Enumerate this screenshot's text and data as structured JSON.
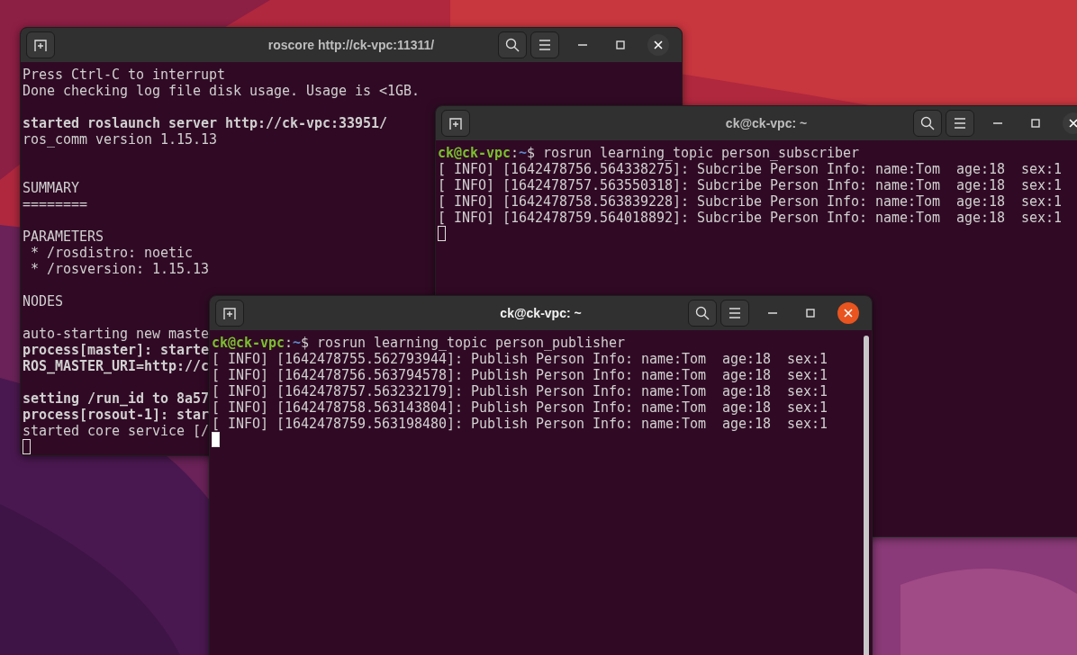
{
  "windows": [
    {
      "title": "roscore http://ck-vpc:11311/",
      "focused": false,
      "scrollbar": false,
      "lines": [
        {
          "kind": "text",
          "text": "Press Ctrl-C to interrupt",
          "bold": false
        },
        {
          "kind": "text",
          "text": "Done checking log file disk usage. Usage is <1GB.",
          "bold": false
        },
        {
          "kind": "blank"
        },
        {
          "kind": "text",
          "text": "started roslaunch server http://ck-vpc:33951/",
          "bold": true
        },
        {
          "kind": "text",
          "text": "ros_comm version 1.15.13",
          "bold": false
        },
        {
          "kind": "blank"
        },
        {
          "kind": "blank"
        },
        {
          "kind": "text",
          "text": "SUMMARY",
          "bold": false
        },
        {
          "kind": "text",
          "text": "========",
          "bold": false
        },
        {
          "kind": "blank"
        },
        {
          "kind": "text",
          "text": "PARAMETERS",
          "bold": false
        },
        {
          "kind": "text",
          "text": " * /rosdistro: noetic",
          "bold": false
        },
        {
          "kind": "text",
          "text": " * /rosversion: 1.15.13",
          "bold": false
        },
        {
          "kind": "blank"
        },
        {
          "kind": "text",
          "text": "NODES",
          "bold": false
        },
        {
          "kind": "blank"
        },
        {
          "kind": "text",
          "text": "auto-starting new maste",
          "bold": false
        },
        {
          "kind": "text",
          "text": "process[master]: starte",
          "bold": true
        },
        {
          "kind": "text",
          "text": "ROS_MASTER_URI=http://c",
          "bold": true
        },
        {
          "kind": "blank"
        },
        {
          "kind": "text",
          "text": "setting /run_id to 8a57",
          "bold": true
        },
        {
          "kind": "text",
          "text": "process[rosout-1]: star",
          "bold": true
        },
        {
          "kind": "text",
          "text": "started core service [/",
          "bold": false
        },
        {
          "kind": "cursor"
        }
      ]
    },
    {
      "title": "ck@ck-vpc: ~",
      "focused": false,
      "scrollbar": false,
      "lines": [
        {
          "kind": "prompt",
          "user": "ck@ck-vpc",
          "sep": ":",
          "path": "~",
          "symbol": "$",
          "command": "rosrun learning_topic person_subscriber"
        },
        {
          "kind": "text",
          "text": "[ INFO] [1642478756.564338275]: Subcribe Person Info: name:Tom  age:18  sex:1",
          "bold": false
        },
        {
          "kind": "text",
          "text": "[ INFO] [1642478757.563550318]: Subcribe Person Info: name:Tom  age:18  sex:1",
          "bold": false
        },
        {
          "kind": "text",
          "text": "[ INFO] [1642478758.563839228]: Subcribe Person Info: name:Tom  age:18  sex:1",
          "bold": false
        },
        {
          "kind": "text",
          "text": "[ INFO] [1642478759.564018892]: Subcribe Person Info: name:Tom  age:18  sex:1",
          "bold": false
        },
        {
          "kind": "cursor"
        }
      ]
    },
    {
      "title": "ck@ck-vpc: ~",
      "focused": true,
      "scrollbar": true,
      "lines": [
        {
          "kind": "prompt",
          "user": "ck@ck-vpc",
          "sep": ":",
          "path": "~",
          "symbol": "$",
          "command": "rosrun learning_topic person_publisher"
        },
        {
          "kind": "text",
          "text": "[ INFO] [1642478755.562793944]: Publish Person Info: name:Tom  age:18  sex:1",
          "bold": false
        },
        {
          "kind": "text",
          "text": "[ INFO] [1642478756.563794578]: Publish Person Info: name:Tom  age:18  sex:1",
          "bold": false
        },
        {
          "kind": "text",
          "text": "[ INFO] [1642478757.563232179]: Publish Person Info: name:Tom  age:18  sex:1",
          "bold": false
        },
        {
          "kind": "text",
          "text": "[ INFO] [1642478758.563143804]: Publish Person Info: name:Tom  age:18  sex:1",
          "bold": false
        },
        {
          "kind": "text",
          "text": "[ INFO] [1642478759.563198480]: Publish Person Info: name:Tom  age:18  sex:1",
          "bold": false
        },
        {
          "kind": "cursor"
        }
      ]
    }
  ]
}
